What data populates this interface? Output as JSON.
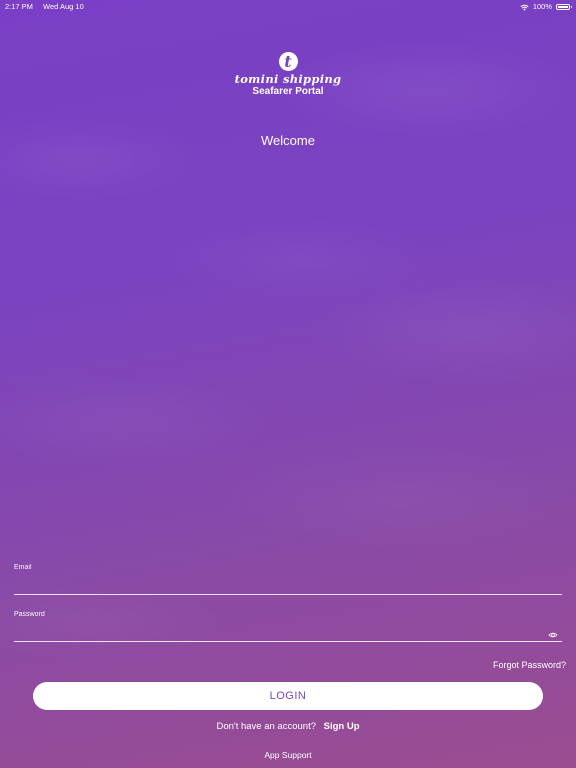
{
  "status_bar": {
    "time": "2:17 PM",
    "date": "Wed Aug 10",
    "battery": "100%"
  },
  "logo": {
    "mark": "t",
    "brand": "tomini shipping",
    "portal": "Seafarer Portal"
  },
  "welcome": "Welcome",
  "form": {
    "email_label": "Email",
    "email_value": "",
    "password_label": "Password",
    "password_value": "",
    "forgot_password": "Forgot Password?",
    "login_label": "LOGIN",
    "no_account_text": "Don't have an account?",
    "signup_label": "Sign Up",
    "app_support": "App Support"
  },
  "colors": {
    "accent": "#7b45c4",
    "background_top": "#7a3fc6",
    "background_bottom": "#9b4d90"
  }
}
